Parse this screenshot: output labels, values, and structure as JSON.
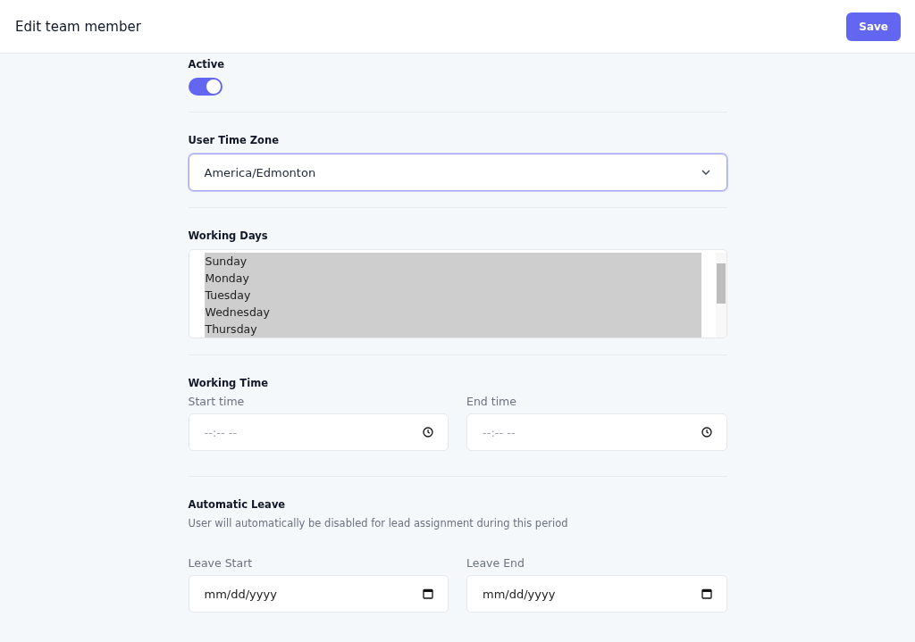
{
  "header": {
    "title": "Edit team member",
    "save_button": "Save"
  },
  "active": {
    "label": "Active",
    "on": true
  },
  "time_zone": {
    "label": "User Time Zone",
    "value": "America/Edmonton"
  },
  "working_days": {
    "label": "Working Days",
    "items": [
      {
        "label": "Sunday",
        "selected": true
      },
      {
        "label": "Monday",
        "selected": true
      },
      {
        "label": "Tuesday",
        "selected": true
      },
      {
        "label": "Wednesday",
        "selected": true
      },
      {
        "label": "Thursday",
        "selected": true
      }
    ]
  },
  "working_time": {
    "label": "Working Time",
    "fields": [
      {
        "kind": "time",
        "label": "Start time",
        "placeholder": "--:-- --"
      },
      {
        "kind": "time",
        "label": "End time",
        "placeholder": "--:-- --"
      }
    ]
  },
  "automatic_leave": {
    "label": "Automatic Leave",
    "description": "User will automatically be disabled for lead assignment during this period",
    "fields": [
      {
        "kind": "date",
        "label": "Leave Start",
        "placeholder": "mm/dd/yyyy"
      },
      {
        "kind": "date",
        "label": "Leave End",
        "placeholder": "mm/dd/yyyy"
      }
    ]
  }
}
